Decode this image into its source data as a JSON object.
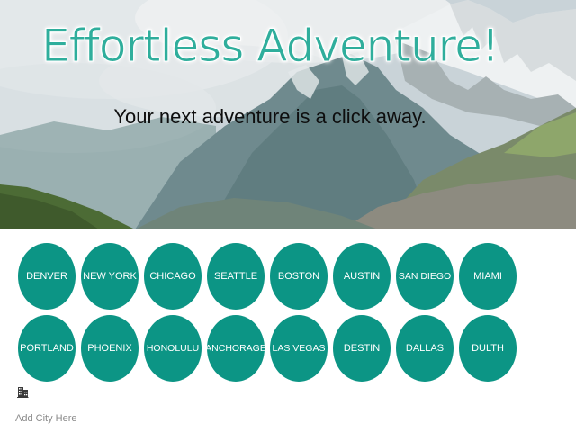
{
  "hero": {
    "title": "Effortless Adventure!",
    "subtitle": "Your next adventure is a click away."
  },
  "cities": {
    "row1": [
      "DENVER",
      "NEW YORK",
      "CHICAGO",
      "SEATTLE",
      "BOSTON",
      "AUSTIN",
      "SAN DIEGO",
      "MIAMI"
    ],
    "row2": [
      "PORTLAND",
      "PHOENIX",
      "HONOLULU",
      "ANCHORAGE",
      "LAS VEGAS",
      "DESTIN",
      "DALLAS",
      "DULTH"
    ]
  },
  "add_city": {
    "icon": "city-building-icon",
    "placeholder": "Add City Here"
  },
  "colors": {
    "accent": "#0c9585",
    "title": "#2fae9c",
    "button_text": "#ffffff",
    "placeholder": "#8a8a8a"
  }
}
